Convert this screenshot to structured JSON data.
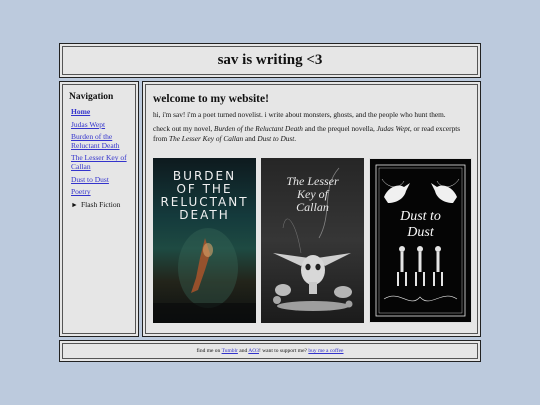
{
  "header": {
    "title": "sav is writing <3"
  },
  "nav": {
    "heading": "Navigation",
    "items": [
      {
        "label": "Home"
      },
      {
        "label": "Judas Wept"
      },
      {
        "label": "Burden of the Reluctant Death"
      },
      {
        "label": "The Lesser Key of Callan"
      },
      {
        "label": "Dust to Dust"
      },
      {
        "label": "Poetry"
      },
      {
        "label": "Flash Fiction"
      }
    ],
    "collapsed_marker": "►"
  },
  "main": {
    "heading": "welcome to my website!",
    "intro": "hi, i'm sav! i'm a poet turned novelist. i write about monsters, ghosts, and the people who hunt them.",
    "novel": {
      "t1": "check out my novel, ",
      "book1": "Burden of the Reluctant Death",
      "t2": " and the prequel novella, ",
      "book2": "Judas Wept",
      "t3": ", or read excerpts from ",
      "book3": "The Lesser Key of Callan",
      "t4": " and ",
      "book4": "Dust to Dust",
      "t5": "."
    },
    "covers": [
      {
        "title_line1": "BURDEN",
        "title_line2": "OF THE",
        "title_line3": "RELUCTANT",
        "title_line4": "DEATH"
      },
      {
        "title_line1": "The Lesser",
        "title_line2": "Key of",
        "title_line3": "Callan"
      },
      {
        "title_line1": "Dust to",
        "title_line2": "Dust"
      }
    ]
  },
  "footer": {
    "t1": "find me on ",
    "link1": "Tumblr",
    "t2": " and ",
    "link2": "AO3",
    "t3": "! want to support me? ",
    "link3": "buy me a coffee"
  },
  "colors": {
    "page_bg": "#bccadd",
    "panel_bg": "#e6e6e6",
    "link": "#3333cc"
  }
}
